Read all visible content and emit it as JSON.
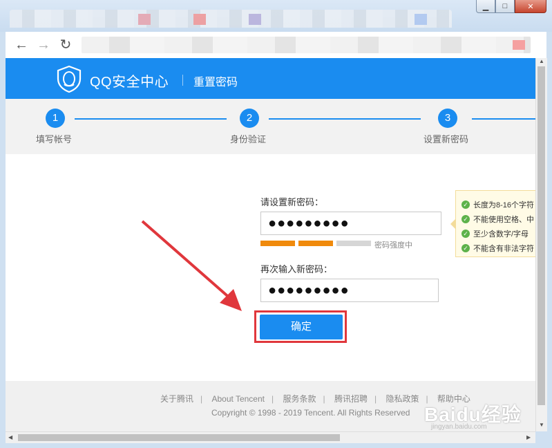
{
  "window": {
    "minimize_glyph": "▁",
    "maximize_glyph": "□",
    "close_glyph": "✕"
  },
  "browser": {
    "back_glyph": "←",
    "forward_glyph": "→",
    "reload_glyph": "↻"
  },
  "site": {
    "logo_text": "QQ安全中心",
    "header_subtitle": "重置密码",
    "brand_color": "#1a8cf0"
  },
  "steps": [
    {
      "number": "1",
      "label": "填写帐号"
    },
    {
      "number": "2",
      "label": "身份验证"
    },
    {
      "number": "3",
      "label": "设置新密码"
    }
  ],
  "form": {
    "new_password_label": "请设置新密码：",
    "new_password_value": "●●●●●●●●●",
    "strength_label": "密码强度中",
    "strength_level": "2/3",
    "confirm_password_label": "再次输入新密码：",
    "confirm_password_value": "●●●●●●●●●",
    "submit_label": "确定"
  },
  "tips": [
    "长度为8-16个字符",
    "不能使用空格、中",
    "至少含数字/字母",
    "不能含有非法字符"
  ],
  "footer": {
    "links": [
      "关于腾讯",
      "About Tencent",
      "服务条款",
      "腾讯招聘",
      "隐私政策",
      "帮助中心"
    ],
    "copyright": "Copyright © 1998 - 2019 Tencent. All Rights Reserved"
  },
  "watermark": {
    "text": "Baidu经验",
    "subtext": "jingyan.baidu.com"
  },
  "colors": {
    "strength_filled": "#f08a0c",
    "strength_empty": "#d6d6d6",
    "highlight_border": "#e0373c",
    "arrow": "#e0373c"
  }
}
